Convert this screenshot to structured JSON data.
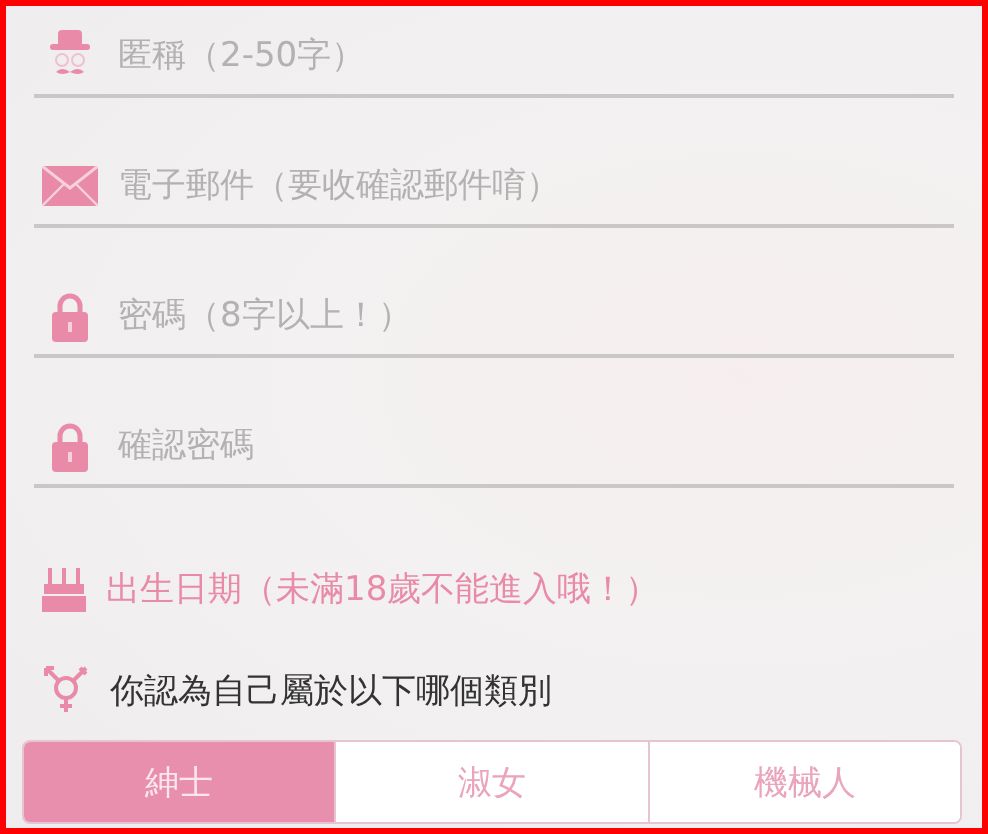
{
  "fields": [
    {
      "placeholder": "匿稱（2-50字）"
    },
    {
      "placeholder": "電子郵件（要收確認郵件唷）"
    },
    {
      "placeholder": "密碼（8字以上！）"
    },
    {
      "placeholder": "確認密碼"
    }
  ],
  "birthday": {
    "label": "出生日期（未滿18歲不能進入哦！）"
  },
  "gender": {
    "question": "你認為自己屬於以下哪個類別",
    "options": [
      {
        "label": "紳士",
        "selected": true
      },
      {
        "label": "淑女",
        "selected": false
      },
      {
        "label": "機械人",
        "selected": false
      }
    ]
  }
}
